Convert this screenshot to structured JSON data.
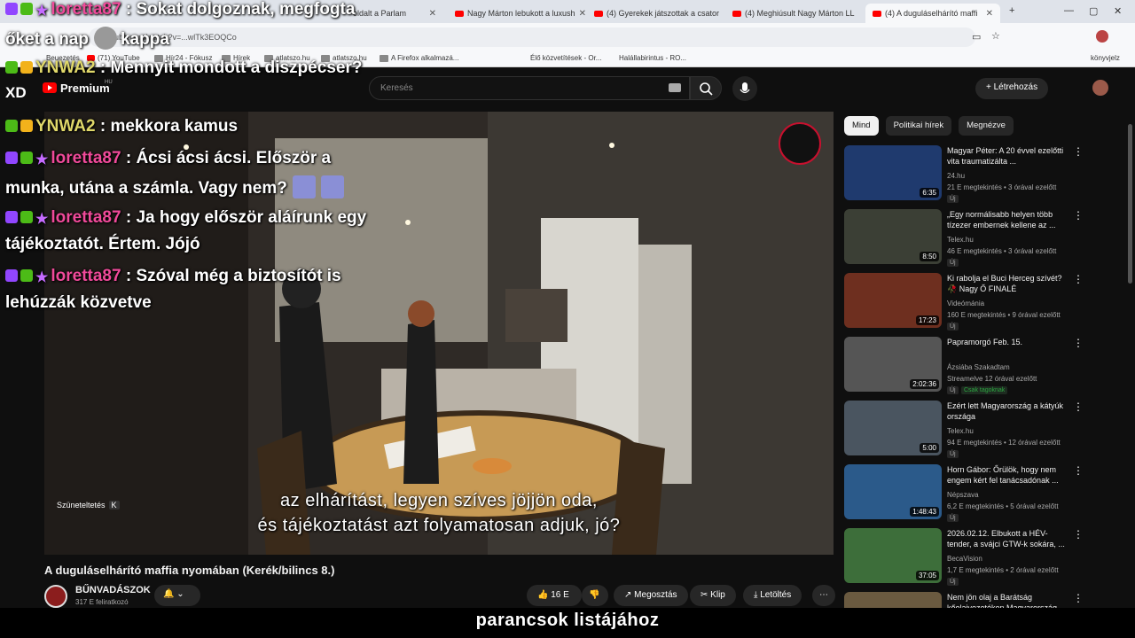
{
  "browser": {
    "tabs": [
      {
        "label": "oldalt a Parlam",
        "active": false
      },
      {
        "label": "Nagy Márton lebukott a luxush",
        "active": false
      },
      {
        "label": "(4) Gyerekek játszottak a csator",
        "active": false
      },
      {
        "label": "(4) Meghiúsult Nagy Márton LL",
        "active": false
      },
      {
        "label": "(4) A duguláselhárító maffi",
        "active": true
      }
    ],
    "url": "youtube.com/watch?v=...wlTk3EOQCo",
    "bookmarks": [
      "Beuezetés",
      "(71) YouTube",
      "Hír24 - Fókusz",
      "Hírek",
      "atlatszo.hu",
      "atlatszo.hu",
      "A Firefox alkalmazá...",
      "Élő közvetítések - Or...",
      "Halállabirintus - RO...",
      "könyvjelz"
    ]
  },
  "youtube": {
    "logo_text": "Premium",
    "logo_region": "HU",
    "search_placeholder": "Keresés",
    "create_label": "Létrehozás"
  },
  "video": {
    "subtitle_line1": "az elhárítást, legyen szíves jöjjön oda,",
    "subtitle_line2": "és tájékoztatást azt folyamatosan adjuk, jó?",
    "pause_tip": "Szüneteltetés",
    "pause_key": "K",
    "title": "A duguláselhárító maffia nyomában (Kerék/bilincs 8.)",
    "channel_name": "BŰNVADÁSZOK",
    "channel_subs": "317 E feliratkozó",
    "likes": "16 E",
    "share": "Megosztás",
    "clip": "Klip",
    "download": "Letöltés"
  },
  "chips": [
    "Mind",
    "Politikai hírek",
    "Megnézve"
  ],
  "recommendations": [
    {
      "title": "Magyar Péter: A 20 évvel ezelőtti vita traumatizálta ...",
      "channel": "24.hu",
      "meta": "21 E megtekintés • 3 órával ezelőtt",
      "badge": "Új",
      "duration": "6:35",
      "color": "#1f3a6e"
    },
    {
      "title": "„Egy normálisabb helyen több tízezer embernek kellene az ...",
      "channel": "Telex.hu",
      "meta": "46 E megtekintés • 3 órával ezelőtt",
      "badge": "Új",
      "duration": "8:50",
      "color": "#3b3f35"
    },
    {
      "title": "Ki rabolja el Buci Herceg szívét? 🥀 Nagy Ő FINALÉ",
      "channel": "Videómánia",
      "meta": "160 E megtekintés • 9 órával ezelőtt",
      "badge": "Új",
      "duration": "17:23",
      "color": "#6e2f1f"
    },
    {
      "title": "Papramorgó Feb. 15.",
      "channel": "Ázsiába Szakadtam",
      "meta": "Streamelve 12 órával ezelőtt",
      "badge": "Új",
      "member": "Csak tagoknak",
      "duration": "2:02:36",
      "color": "#555"
    },
    {
      "title": "Ezért lett Magyarország a kátyúk országa",
      "channel": "Telex.hu",
      "meta": "94 E megtekintés • 12 órával ezelőtt",
      "badge": "Új",
      "duration": "5:00",
      "color": "#4a5560"
    },
    {
      "title": "Horn Gábor: Őrülök, hogy nem engem kért fel tanácsadónak ...",
      "channel": "Népszava",
      "meta": "6,2 E megtekintés • 5 órával ezelőtt",
      "badge": "Új",
      "duration": "1:48:43",
      "color": "#2b5a8a"
    },
    {
      "title": "2026.02.12. Elbukott a HÉV-tender, a svájci GTW-k sokára, ...",
      "channel": "BecaVision",
      "meta": "1,7 E megtekintés • 2 órával ezelőtt",
      "badge": "Új",
      "duration": "37:05",
      "color": "#3d6e3a"
    },
    {
      "title": "Nem jön olaj a Barátság kőolajvezetéken Magyarország...",
      "channel": "",
      "meta": "",
      "badge": "",
      "duration": "",
      "color": "#6a5a40"
    }
  ],
  "chat": [
    {
      "user": "loretta87",
      "msg": "Sokat dolgoznak, megfogta",
      "badges": [
        "tw",
        "pr",
        "st"
      ]
    },
    {
      "user": "",
      "msg": "őket a nap",
      "tail": "kappa",
      "badges": []
    },
    {
      "user": "YNWA2",
      "msg": "Mennyit mondott a diszpécser?",
      "badges": [
        "k",
        "cr"
      ]
    },
    {
      "user": "YNWA2",
      "msg": "mekkora kamus",
      "badges": [
        "k",
        "cr"
      ]
    },
    {
      "user": "loretta87",
      "msg": "Ácsi ácsi ácsi. Először a",
      "badges": [
        "tw",
        "pr",
        "st"
      ]
    },
    {
      "user": "",
      "msg": "munka, utána a számla. Vagy nem?",
      "badges": []
    },
    {
      "user": "loretta87",
      "msg": "Ja hogy először aláírunk egy",
      "badges": [
        "tw",
        "pr",
        "st"
      ]
    },
    {
      "user": "",
      "msg": "tájékoztatót. Értem. Jójó",
      "badges": []
    },
    {
      "user": "loretta87",
      "msg": "Szóval még a biztosítót is",
      "badges": [
        "tw",
        "pr",
        "st"
      ]
    },
    {
      "user": "",
      "msg": "lehúzzák közvetve",
      "badges": []
    }
  ],
  "overlay_xd": "XD",
  "bottom_caption": "parancsok listájához"
}
